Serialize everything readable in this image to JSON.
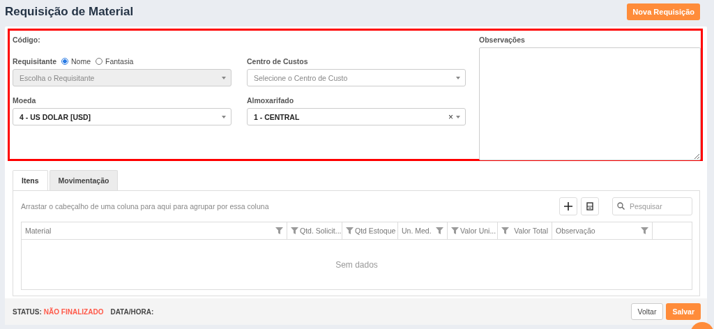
{
  "page_title": "Requisição de Material",
  "new_button": "Nova Requisição",
  "form": {
    "code_label": "Código:",
    "requester": {
      "label": "Requisitante",
      "options": [
        {
          "label": "Nome",
          "selected": true
        },
        {
          "label": "Fantasia",
          "selected": false
        }
      ],
      "placeholder": "Escolha o Requisitante",
      "disabled": true
    },
    "cost_center": {
      "label": "Centro de Custos",
      "placeholder": "Selecione o Centro de Custo"
    },
    "currency": {
      "label": "Moeda",
      "value": "4 - US DOLAR [USD]"
    },
    "warehouse": {
      "label": "Almoxarifado",
      "value": "1 - CENTRAL",
      "clear_icon": "×"
    },
    "notes": {
      "label": "Observações"
    }
  },
  "tabs": [
    {
      "label": "Itens",
      "selected": true
    },
    {
      "label": "Movimentação",
      "selected": false
    }
  ],
  "grid": {
    "group_hint": "Arrastar o cabeçalho de uma coluna para aqui para agrupar por essa coluna",
    "search_placeholder": "Pesquisar",
    "columns": [
      {
        "label": "Material",
        "kind": "filter_after"
      },
      {
        "label": "Qtd. Solicit...",
        "kind": "filter_before"
      },
      {
        "label": "Qtd Estoque",
        "kind": "filter_before"
      },
      {
        "label": "Un. Med.",
        "kind": "filter_after"
      },
      {
        "label": "Valor Uni...",
        "kind": "filter_before"
      },
      {
        "label": "Valor Total",
        "kind": "filter_before_right_text"
      },
      {
        "label": "Observação",
        "kind": "filter_after"
      }
    ],
    "empty_text": "Sem dados"
  },
  "footer": {
    "status_label": "STATUS:",
    "status_value": "NÃO FINALIZADO",
    "datetime_label": "DATA/HORA:",
    "buttons": [
      {
        "label": "Voltar",
        "kind": "secondary"
      },
      {
        "label": "Salvar",
        "kind": "primary"
      }
    ]
  }
}
